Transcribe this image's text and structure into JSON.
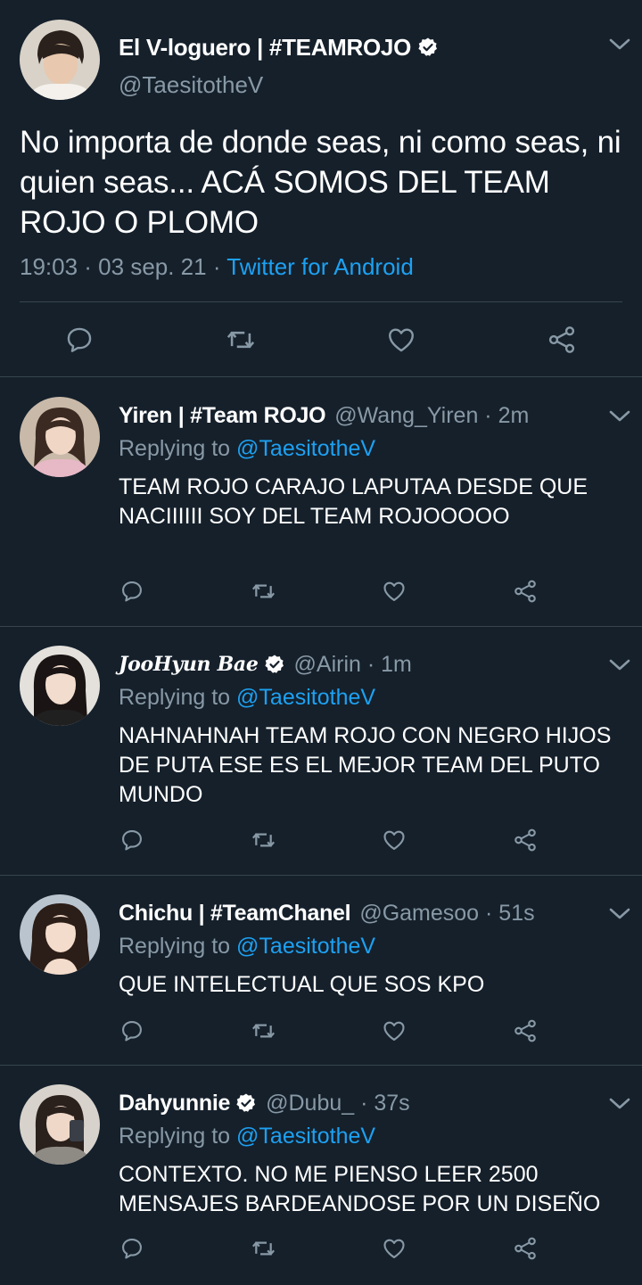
{
  "colors": {
    "background": "#15202b",
    "text": "#ffffff",
    "secondary": "#8899a6",
    "accent": "#1da1f2",
    "divider": "#38444d"
  },
  "main_tweet": {
    "name": "El V-loguero | #TEAMROJO",
    "verified": true,
    "handle": "@TaesitotheV",
    "text": "No importa de donde seas, ni como seas, ni quien seas... ACÁ SOMOS DEL TEAM ROJO O PLOMO",
    "datetime": "19:03 · 03 sep. 21",
    "separator": " · ",
    "source": "Twitter for Android",
    "icons": [
      "reply-icon",
      "retweet-icon",
      "like-icon",
      "share-icon"
    ]
  },
  "replying_label": "Replying to",
  "replies": [
    {
      "name": "Yiren | #Team ROJO",
      "verified": false,
      "handle_time": "@Wang_Yiren · 2m",
      "replying_to": "@TaesitotheV",
      "text": "TEAM ROJO CARAJO LAPUTAA DESDE QUE NACIIIIII SOY DEL TEAM ROJOOOOO"
    },
    {
      "name": "JooHyun Bae",
      "verified": true,
      "handle_time": "@Airin · 1m",
      "replying_to": "@TaesitotheV",
      "text": "NAHNAHNAH TEAM ROJO CON NEGRO HIJOS DE PUTA ESE ES EL MEJOR TEAM DEL PUTO MUNDO"
    },
    {
      "name": "Chichu | #TeamChanel",
      "verified": false,
      "handle_time": "@Gamesoo · 51s",
      "replying_to": "@TaesitotheV",
      "text": "QUE INTELECTUAL QUE SOS KPO"
    },
    {
      "name": "Dahyunnie",
      "verified": true,
      "handle_time": "@Dubu_ · 37s",
      "replying_to": "@TaesitotheV",
      "text": "CONTEXTO. NO ME PIENSO LEER 2500 MENSAJES BARDEANDOSE POR UN DISEÑO"
    }
  ]
}
